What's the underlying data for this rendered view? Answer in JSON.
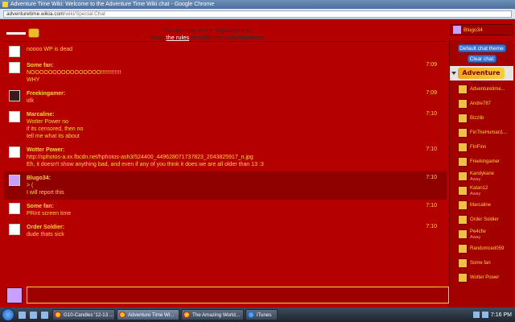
{
  "window": {
    "title": "Adventure Time Wiki: Welcome to the Adventure Time Wiki chat - Google Chrome",
    "url_host": "adventuretime.wikia.com",
    "url_path": "/wiki/Special:Chat"
  },
  "header": {
    "notice_line1": "You are now in the Nightosphere.",
    "notice_read": "Read",
    "notice_rules": "the rules",
    "notice_rest": "or suffer the consequences.",
    "current_user": "Blugo34"
  },
  "messages": [
    {
      "name": "",
      "lines": [
        "noooo WP is dead"
      ],
      "time": "",
      "avatar": "white"
    },
    {
      "name": "Some fan:",
      "lines": [
        "NOOOOOOOOOOOOOOOO!!!!!!!!!!!!!",
        "WHY"
      ],
      "time": "7:09",
      "avatar": "white"
    },
    {
      "name": "Freekingamer:",
      "lines": [
        "idk"
      ],
      "time": "7:09",
      "avatar": "dark"
    },
    {
      "name": "Marcaline:",
      "lines": [
        "Wotter Power no",
        "if its censored, then no",
        "tell me what its about"
      ],
      "time": "7:10",
      "avatar": "white"
    },
    {
      "name": "Wotter Power:",
      "lines": [
        "http://sphotos-a.xx.fbcdn.net/hphotos-ash3/524400_449628071737823_2043825917_n.jpg",
        "Eh, it doesn't show anything bad, and even if any of you think it does we are all older than 13 :3"
      ],
      "time": "7:10",
      "avatar": "white"
    },
    {
      "name": "Blugo34:",
      "lines": [
        "> (",
        "I will report this"
      ],
      "time": "7:10",
      "avatar": "purple",
      "highlight": true
    },
    {
      "name": "Some fan:",
      "lines": [
        "PRint screen time"
      ],
      "time": "7:10",
      "avatar": "white"
    },
    {
      "name": "Order Soldier:",
      "lines": [
        "dude thats sick"
      ],
      "time": "7:10",
      "avatar": "white"
    }
  ],
  "composer": {
    "value": ""
  },
  "sidebar": {
    "theme_button": "Default chat theme",
    "clear_button": "Clear chat",
    "wiki_logo": "Adventure Time",
    "users": [
      {
        "name": "Adventuretime...",
        "status": ""
      },
      {
        "name": "Andre787",
        "status": ""
      },
      {
        "name": "Bizzlib",
        "status": ""
      },
      {
        "name": "FinTheHuman1...",
        "status": ""
      },
      {
        "name": "FInFinn",
        "status": ""
      },
      {
        "name": "Freekingamer",
        "status": ""
      },
      {
        "name": "Kandykane",
        "status": "Away"
      },
      {
        "name": "Katan12",
        "status": "Away"
      },
      {
        "name": "Marcaline",
        "status": ""
      },
      {
        "name": "Order Soldier",
        "status": ""
      },
      {
        "name": "Pe4cfw",
        "status": "Away"
      },
      {
        "name": "Randomced059",
        "status": ""
      },
      {
        "name": "Some fan",
        "status": ""
      },
      {
        "name": "Wotter Power",
        "status": ""
      }
    ]
  },
  "taskbar": {
    "tasks": [
      {
        "label": "G10-Candles '12-13 ...",
        "icon": "chrome-icon"
      },
      {
        "label": "Adventure Time Wi...",
        "icon": "chrome-icon",
        "active": true
      },
      {
        "label": "The Amazing World...",
        "icon": "chrome-icon"
      },
      {
        "label": "iTunes",
        "icon": "itunes-icon"
      }
    ],
    "clock": "7:16 PM"
  }
}
